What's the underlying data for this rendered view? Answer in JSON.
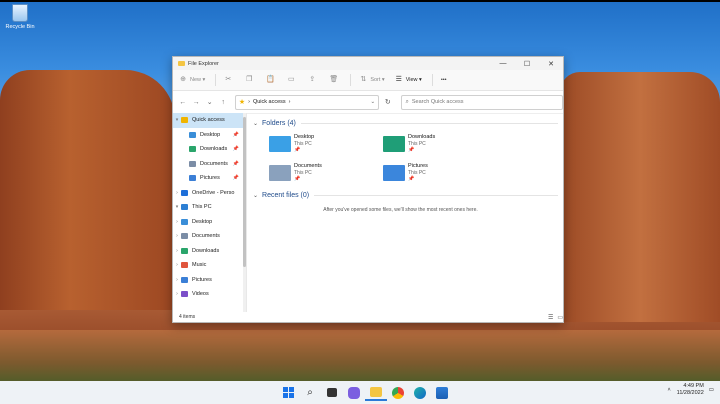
{
  "desktop": {
    "recycle_bin_label": "Recycle Bin"
  },
  "window": {
    "title": "File Explorer",
    "controls": {
      "minimize": "—",
      "maximize": "☐",
      "close": "✕"
    },
    "toolbar": {
      "new_label": "New",
      "sort_label": "Sort",
      "view_label": "View",
      "more_label": "•••"
    },
    "address": {
      "location": "Quick access",
      "separator": "›"
    },
    "search": {
      "placeholder": "Search Quick access"
    },
    "sidebar": [
      {
        "label": "Quick access",
        "icon": "star-icon",
        "color": "#f0b400",
        "selected": true,
        "chevron": "▾",
        "pinned": false
      },
      {
        "label": "Desktop",
        "icon": "desktop-folder-icon",
        "color": "#3a8ed8",
        "pinned": true
      },
      {
        "label": "Downloads",
        "icon": "downloads-folder-icon",
        "color": "#2aa56b",
        "pinned": true
      },
      {
        "label": "Documents",
        "icon": "documents-folder-icon",
        "color": "#7b8da6",
        "pinned": true
      },
      {
        "label": "Pictures",
        "icon": "pictures-folder-icon",
        "color": "#3b7fd6",
        "pinned": true
      },
      {
        "label": "OneDrive - Perso",
        "icon": "onedrive-icon",
        "color": "#1e6fd9",
        "chevron": "›"
      },
      {
        "label": "This PC",
        "icon": "pc-icon",
        "color": "#2d7fd3",
        "chevron": "▾"
      },
      {
        "label": "Desktop",
        "icon": "desktop-folder-icon",
        "color": "#3a8ed8",
        "chevron": "›"
      },
      {
        "label": "Documents",
        "icon": "documents-folder-icon",
        "color": "#7b8da6",
        "chevron": "›"
      },
      {
        "label": "Downloads",
        "icon": "downloads-folder-icon",
        "color": "#2aa56b",
        "chevron": "›"
      },
      {
        "label": "Music",
        "icon": "music-folder-icon",
        "color": "#e0553d",
        "chevron": "›"
      },
      {
        "label": "Pictures",
        "icon": "pictures-folder-icon",
        "color": "#3b7fd6",
        "chevron": "›"
      },
      {
        "label": "Videos",
        "icon": "videos-folder-icon",
        "color": "#7c4fc9",
        "chevron": "›"
      }
    ],
    "folders_header": "Folders (4)",
    "folders": [
      {
        "name": "Desktop",
        "location": "This PC",
        "icon": "desktop-folder-icon",
        "color": "#3aa0e6"
      },
      {
        "name": "Downloads",
        "location": "This PC",
        "icon": "downloads-folder-icon",
        "color": "#1f9e77"
      },
      {
        "name": "Documents",
        "location": "This PC",
        "icon": "documents-folder-icon",
        "color": "#8aa1bd"
      },
      {
        "name": "Pictures",
        "location": "This PC",
        "icon": "pictures-folder-icon",
        "color": "#3b86dc"
      }
    ],
    "recent_header": "Recent files (0)",
    "recent_empty": "After you've opened some files, we'll show the most recent ones here.",
    "status": "4 items"
  },
  "taskbar": {
    "time": "4:49 PM",
    "date": "11/28/2022"
  }
}
